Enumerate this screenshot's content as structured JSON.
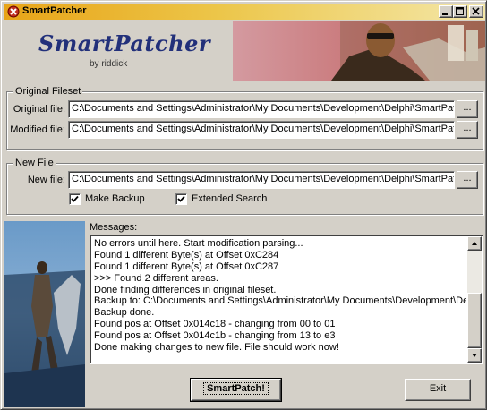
{
  "window": {
    "title": "SmartPatcher"
  },
  "banner": {
    "title": "SmartPatcher",
    "subtitle": "by riddick"
  },
  "original_fileset": {
    "legend": "Original Fileset",
    "original_label": "Original file:",
    "original_value": "C:\\Documents and Settings\\Administrator\\My Documents\\Development\\Delphi\\SmartPatc",
    "modified_label": "Modified file:",
    "modified_value": "C:\\Documents and Settings\\Administrator\\My Documents\\Development\\Delphi\\SmartPatc",
    "browse_label": "..."
  },
  "new_file": {
    "legend": "New File",
    "new_label": "New file:",
    "new_value": "C:\\Documents and Settings\\Administrator\\My Documents\\Development\\Delphi\\SmartPatc",
    "browse_label": "...",
    "make_backup_label": "Make Backup",
    "make_backup_checked": true,
    "extended_search_label": "Extended Search",
    "extended_search_checked": true
  },
  "messages": {
    "label": "Messages:",
    "lines": [
      "No errors until here. Start modification parsing...",
      "Found 1 different Byte(s) at Offset 0xC284",
      "Found 1 different Byte(s) at Offset 0xC287",
      ">>> Found 2 different areas.",
      "Done finding differences in original fileset.",
      "Backup to: C:\\Documents and Settings\\Administrator\\My Documents\\Development\\Delphi",
      "Backup done.",
      "Found pos at Offset 0x014c18 - changing from 00 to 01",
      "Found pos at Offset 0x014c1b - changing from 13 to e3",
      "Done making changes to new file. File should work now!"
    ]
  },
  "buttons": {
    "smartpatch": "SmartPatch!",
    "exit": "Exit"
  }
}
